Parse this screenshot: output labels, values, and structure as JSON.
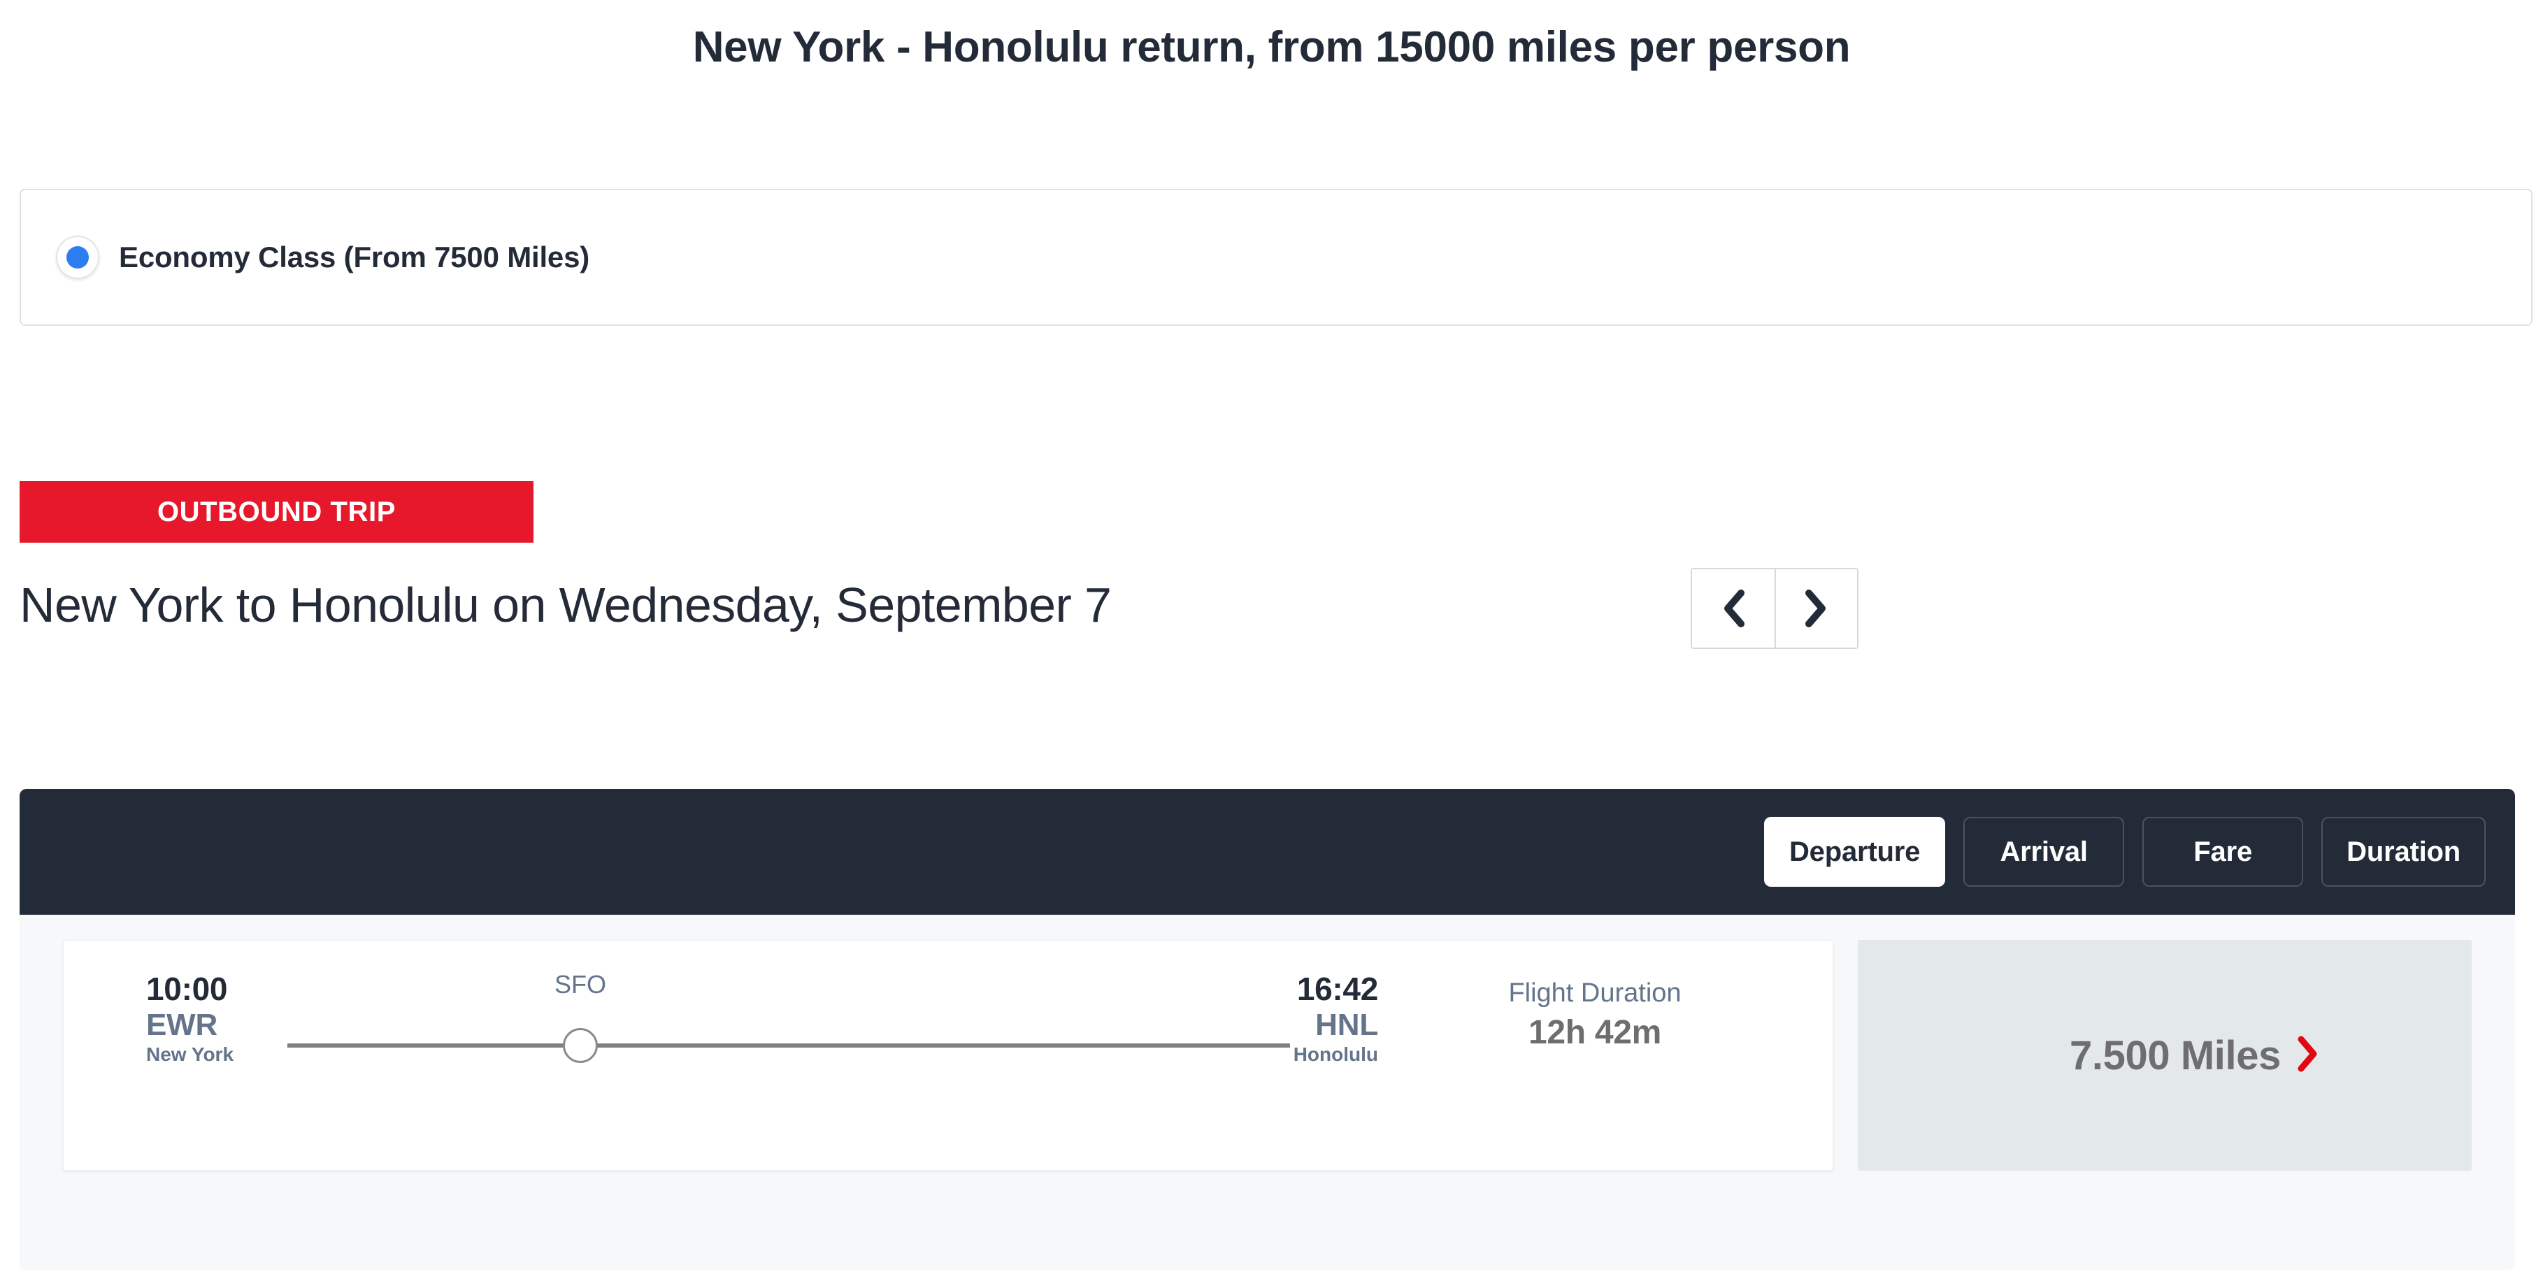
{
  "page": {
    "title": "New York - Honolulu return, from 15000 miles per person"
  },
  "cabin_class": {
    "selected_label": "Economy Class (From 7500 Miles)",
    "selected": true,
    "radio_accent": "#2E7DF0"
  },
  "trip": {
    "badge_label": "OUTBOUND TRIP",
    "badge_color": "#E7182B",
    "heading": "New York to Honolulu on Wednesday, September 7",
    "prev_day_icon": "chevron-left-icon",
    "next_day_icon": "chevron-right-icon"
  },
  "results": {
    "header_color": "#242B38",
    "sort_tabs": [
      {
        "label": "Departure",
        "active": true
      },
      {
        "label": "Arrival",
        "active": false
      },
      {
        "label": "Fare",
        "active": false
      },
      {
        "label": "Duration",
        "active": false
      }
    ],
    "flights": [
      {
        "departure_time": "10:00",
        "departure_code": "EWR",
        "departure_city": "New York",
        "stop_code": "SFO",
        "arrival_time": "16:42",
        "arrival_code": "HNL",
        "arrival_city": "Honolulu",
        "duration_label": "Flight Duration",
        "duration_value": "12h 42m",
        "price_value": "7.500 Miles",
        "price_chevron_icon": "chevron-right-icon",
        "price_chevron_color": "#E30613"
      }
    ]
  }
}
